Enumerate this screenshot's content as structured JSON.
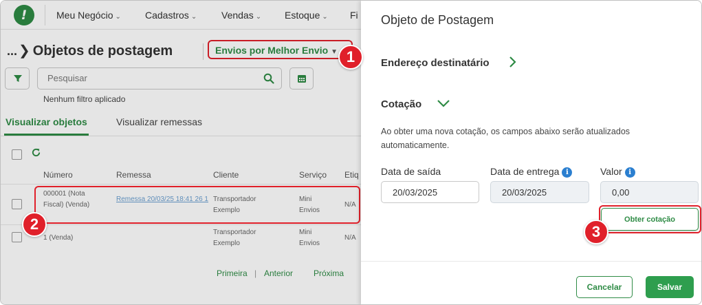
{
  "nav": {
    "logo_glyph": "!",
    "items": [
      {
        "label": "Meu Negócio"
      },
      {
        "label": "Cadastros"
      },
      {
        "label": "Vendas"
      },
      {
        "label": "Estoque"
      },
      {
        "label": "Fi"
      }
    ]
  },
  "page": {
    "breadcrumb_ellipsis": "...",
    "title": "Objetos de postagem",
    "envios_label": "Envios por Melhor Envio",
    "search_placeholder": "Pesquisar",
    "no_filter": "Nenhum filtro aplicado"
  },
  "tabs": [
    {
      "label": "Visualizar objetos",
      "active": true
    },
    {
      "label": "Visualizar remessas",
      "active": false
    }
  ],
  "table": {
    "columns": [
      "Número",
      "Remessa",
      "Cliente",
      "Serviço",
      "Etiq"
    ],
    "rows": [
      {
        "numero": "000001 (Nota Fiscal) (Venda)",
        "remessa": "Remessa 20/03/25 18:41 26 1",
        "cliente": "Transportador Exemplo",
        "servico": "Mini Envios",
        "etiqueta": "N/A"
      },
      {
        "numero": "1 (Venda)",
        "remessa": "",
        "cliente": "Transportador Exemplo",
        "servico": "Mini Envios",
        "etiqueta": "N/A"
      }
    ]
  },
  "pagination": {
    "first": "Primeira",
    "separator": "|",
    "prev": "Anterior",
    "next": "Próxima"
  },
  "drawer": {
    "title": "Objeto de Postagem",
    "section_address": "Endereço destinatário",
    "section_quote": "Cotação",
    "description": "Ao obter uma nova cotação, os campos abaixo serão atualizados automaticamente.",
    "fields": {
      "data_saida": {
        "label": "Data de saída",
        "value": "20/03/2025"
      },
      "data_entrega": {
        "label": "Data de entrega",
        "value": "20/03/2025"
      },
      "valor": {
        "label": "Valor",
        "value": "0,00"
      }
    },
    "info_glyph": "i",
    "obter_button": "Obter cotação",
    "cancel_button": "Cancelar",
    "save_button": "Salvar"
  },
  "annotations": {
    "badge1": "1",
    "badge2": "2",
    "badge3": "3"
  },
  "colors": {
    "brand_green": "#2e8b45",
    "highlight_red": "#e0202a",
    "info_blue": "#2b7fd0"
  }
}
